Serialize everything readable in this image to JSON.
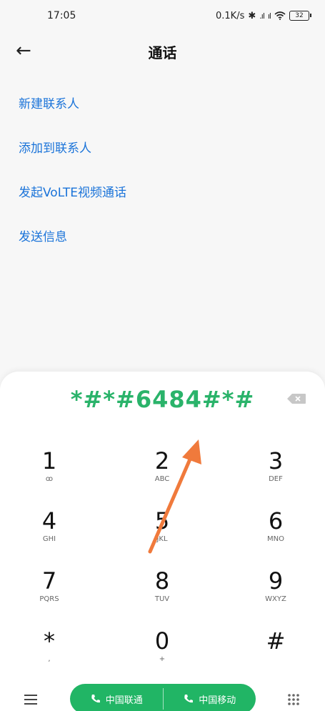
{
  "status_bar": {
    "time": "17:05",
    "net_speed": "0.1K/s",
    "bluetooth_icon": "✱",
    "signal_1": ".ıl",
    "signal_2": "ıl",
    "wifi_icon": "wifi-icon",
    "battery": "32"
  },
  "header": {
    "back_icon": "←",
    "title": "通话"
  },
  "options": [
    {
      "label": "新建联系人"
    },
    {
      "label": "添加到联系人"
    },
    {
      "label": "发起VoLTE视频通话"
    },
    {
      "label": "发送信息"
    }
  ],
  "dialer": {
    "number": "*#*#6484#*#",
    "keys": [
      {
        "digit": "1",
        "letters": "ꝏ"
      },
      {
        "digit": "2",
        "letters": "ABC"
      },
      {
        "digit": "3",
        "letters": "DEF"
      },
      {
        "digit": "4",
        "letters": "GHI"
      },
      {
        "digit": "5",
        "letters": "JKL"
      },
      {
        "digit": "6",
        "letters": "MNO"
      },
      {
        "digit": "7",
        "letters": "PQRS"
      },
      {
        "digit": "8",
        "letters": "TUV"
      },
      {
        "digit": "9",
        "letters": "WXYZ"
      },
      {
        "digit": "*",
        "letters": ","
      },
      {
        "digit": "0",
        "letters": "+"
      },
      {
        "digit": "#",
        "letters": ""
      }
    ],
    "call_buttons": [
      {
        "label": "中国联通"
      },
      {
        "label": "中国移动"
      }
    ]
  },
  "colors": {
    "accent_blue": "#1a73d9",
    "number_green": "#2ab36a",
    "call_green": "#21b565",
    "annotation_arrow": "#f07a3c"
  }
}
